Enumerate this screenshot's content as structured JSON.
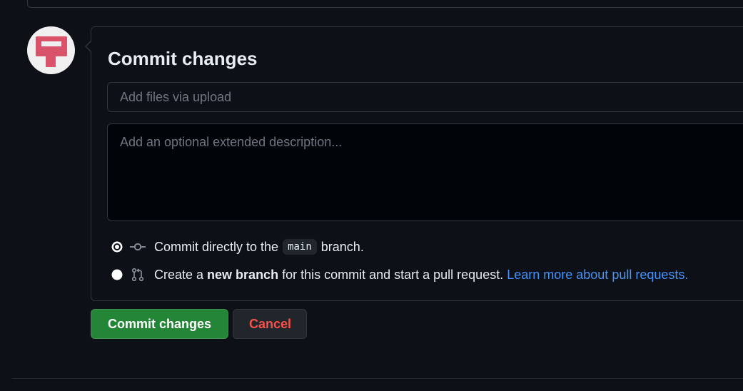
{
  "form": {
    "title": "Commit changes",
    "summary_placeholder": "Add files via upload",
    "description_placeholder": "Add an optional extended description..."
  },
  "options": {
    "direct": {
      "text_before": "Commit directly to the",
      "branch": "main",
      "text_after": "branch.",
      "selected": true,
      "icon": "git-commit-icon"
    },
    "new_branch": {
      "text_before": "Create a",
      "bold": "new branch",
      "text_after": "for this commit and start a pull request.",
      "link": "Learn more about pull requests.",
      "selected": false,
      "icon": "git-pull-request-icon"
    }
  },
  "buttons": {
    "commit": "Commit changes",
    "cancel": "Cancel"
  },
  "colors": {
    "background": "#0d1117",
    "primary_button": "#238636",
    "danger_text": "#f85149",
    "link": "#4493f8",
    "avatar": "#d9536a"
  }
}
